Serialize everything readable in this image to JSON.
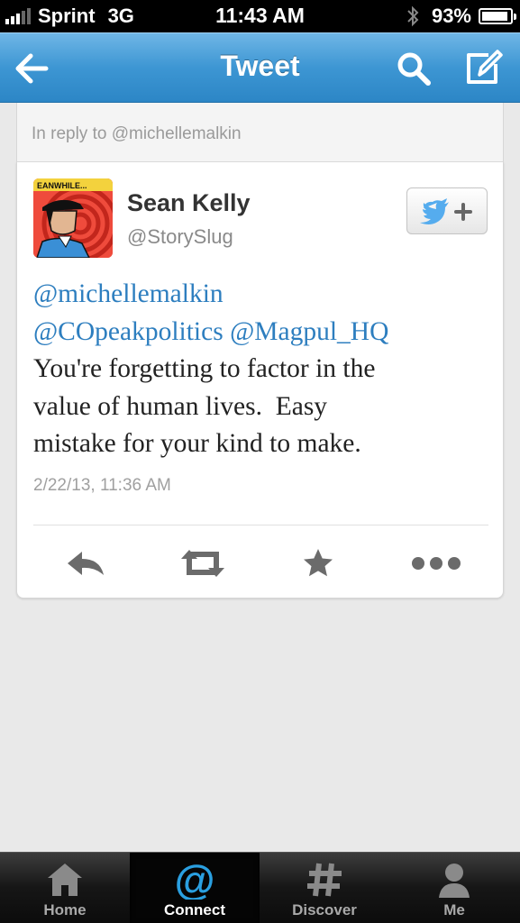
{
  "status_bar": {
    "carrier": "Sprint",
    "network": "3G",
    "time": "11:43 AM",
    "battery": "93%",
    "battery_level": 0.93
  },
  "nav": {
    "title": "Tweet",
    "back_icon": "back-arrow-icon",
    "search_icon": "search-icon",
    "compose_icon": "compose-icon"
  },
  "reply_header": {
    "text": "In reply to @michellemalkin"
  },
  "tweet": {
    "user_name": "Sean Kelly",
    "user_handle": "@StorySlug",
    "mention_1": "@michellemalkin",
    "mention_2": "@COpeakpolitics",
    "mention_3": "@Magpul_HQ",
    "body_line_1": "You're forgetting to factor in the",
    "body_line_2": "value of human lives.  Easy",
    "body_line_3": "mistake for your kind to make.",
    "timestamp": "2/22/13, 11:36 AM",
    "avatar_caption": "EANWHILE..."
  },
  "actions": {
    "reply": "reply-icon",
    "retweet": "retweet-icon",
    "favorite": "star-icon",
    "more": "more-icon"
  },
  "tab_bar": {
    "tabs": [
      {
        "label": "Home",
        "icon": "home-icon"
      },
      {
        "label": "Connect",
        "icon": "at-icon",
        "active": true
      },
      {
        "label": "Discover",
        "icon": "hash-icon"
      },
      {
        "label": "Me",
        "icon": "person-icon"
      }
    ]
  },
  "colors": {
    "nav_blue": "#3d96d3",
    "mention_blue": "#2d7ebf",
    "twitter_bird": "#55acee",
    "connect_blue": "#2a9fe0"
  }
}
